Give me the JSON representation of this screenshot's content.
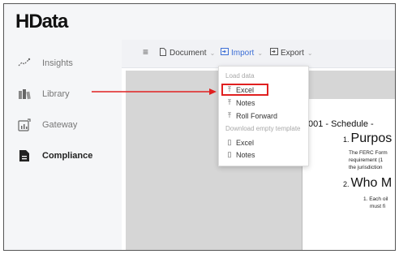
{
  "app": {
    "logo": "HData"
  },
  "sidebar": {
    "items": [
      {
        "label": "Insights",
        "icon": "insights-icon"
      },
      {
        "label": "Library",
        "icon": "library-icon"
      },
      {
        "label": "Gateway",
        "icon": "gateway-icon"
      },
      {
        "label": "Compliance",
        "icon": "compliance-icon",
        "active": true
      }
    ]
  },
  "toolbar": {
    "menu_icon": "menu-icon",
    "document_label": "Document",
    "import_label": "Import",
    "export_label": "Export"
  },
  "import_menu": {
    "load_header": "Load data",
    "load_items": [
      "Excel",
      "Notes",
      "Roll Forward"
    ],
    "template_header": "Download empty template",
    "template_items": [
      "Excel",
      "Notes"
    ]
  },
  "document": {
    "schedule_title": "001 - Schedule -",
    "section1_num": "1.",
    "section1_title": "Purpos",
    "section1_lines": [
      "The FERC Form",
      "requirement (1",
      "the jurisdiction"
    ],
    "section2_num": "2.",
    "section2_title": "Who M",
    "section2_lines": [
      "1. Each oil",
      "must fi"
    ]
  },
  "colors": {
    "accent": "#3d6fd6",
    "annotation": "#e02020",
    "sidebar_bg": "#f5f6f8"
  }
}
